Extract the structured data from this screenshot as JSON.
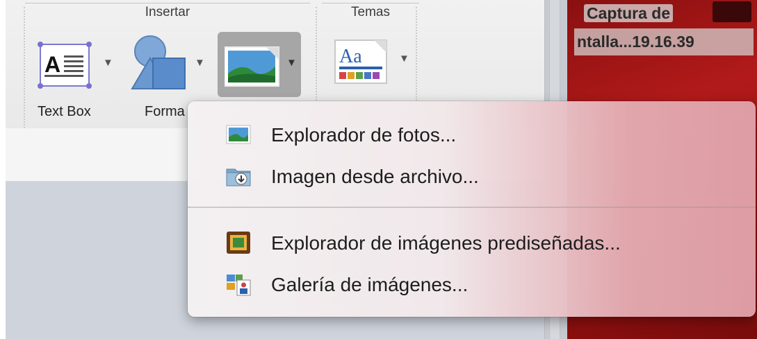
{
  "ribbon": {
    "groups": {
      "insertar": "Insertar",
      "temas": "Temas"
    },
    "tools": {
      "text_box": "Text Box",
      "forma": "Forma",
      "imagen": "",
      "temas": ""
    }
  },
  "picture_menu": {
    "items": [
      {
        "label": "Explorador de fotos...",
        "icon": "photo-browser-icon"
      },
      {
        "label": "Imagen desde archivo...",
        "icon": "image-from-file-icon"
      },
      {
        "label": "Explorador de imágenes prediseñadas...",
        "icon": "clip-art-browser-icon"
      },
      {
        "label": "Galería de imágenes...",
        "icon": "image-gallery-icon"
      }
    ]
  },
  "desktop": {
    "file_label_line1": "Captura de",
    "file_label_line2": "ntalla...19.16.39"
  },
  "colors": {
    "desktop_bg": "#9c1212",
    "menu_tint": "#e0a0a8",
    "selected_button": "#a6a6a6"
  }
}
